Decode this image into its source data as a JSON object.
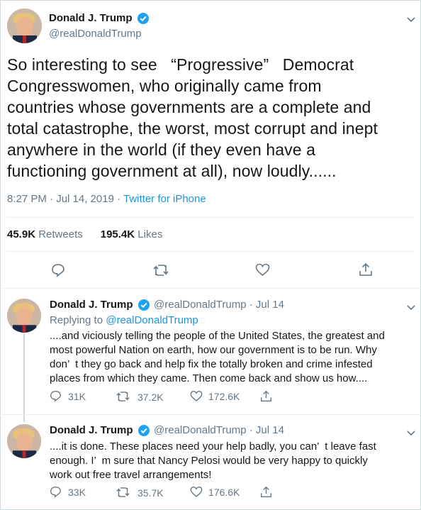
{
  "main_tweet": {
    "author_name": "Donald J. Trump",
    "author_handle": "@realDonaldTrump",
    "text": "So interesting to see   “Progressive”   Democrat\nCongresswomen, who originally came from\ncountries whose governments are a complete and\ntotal catastrophe, the worst, most corrupt and inept\nanywhere in the world (if they even have a\nfunctioning government at all), now loudly......",
    "timestamp": "8:27 PM · Jul 14, 2019 · ",
    "source": "Twitter for iPhone",
    "retweets_count": "45.9K",
    "retweets_label": "Retweets",
    "likes_count": "195.4K",
    "likes_label": "Likes"
  },
  "replies": [
    {
      "author_name": "Donald J. Trump",
      "meta": "@realDonaldTrump · Jul 14",
      "replying_to_label": "Replying to ",
      "replying_to_handle": "@realDonaldTrump",
      "text": "....and viciously telling the people of the United States, the greatest and\nmost powerful Nation on earth, how our government is to be run. Why\ndon’  t they go back and help fix the totally broken and crime infested\nplaces from which they came. Then come back and show us how....",
      "reply_count": "31K",
      "retweet_count": "37.2K",
      "like_count": "172.6K"
    },
    {
      "author_name": "Donald J. Trump",
      "meta": "@realDonaldTrump · Jul 14",
      "text": "....it is done. These places need your help badly, you can’  t leave fast\nenough. I’  m sure that Nancy Pelosi would be very happy to quickly\nwork out free travel arrangements!",
      "reply_count": "33K",
      "retweet_count": "35.7K",
      "like_count": "176.6K"
    }
  ],
  "colors": {
    "accent": "#1b95e0",
    "muted": "#657786",
    "verified": "#1da1f2"
  }
}
